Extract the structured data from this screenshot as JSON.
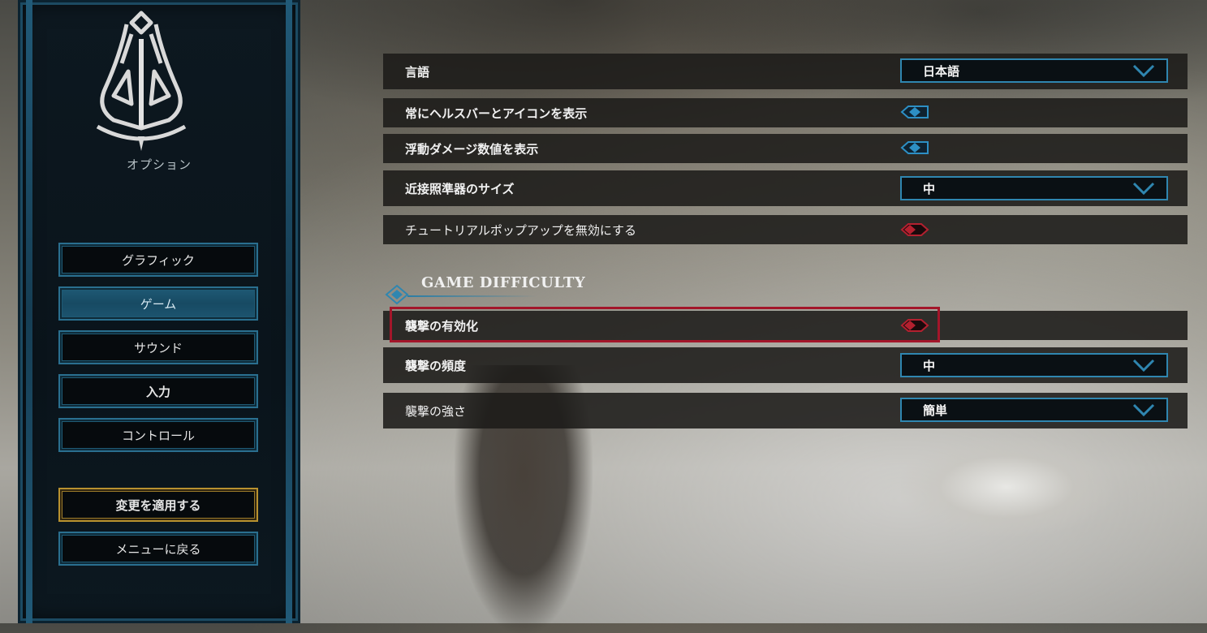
{
  "sidebar": {
    "title": "オプション",
    "logo_icon": "bell-crest-icon",
    "menu": [
      {
        "label": "グラフィック"
      },
      {
        "label": "ゲーム"
      },
      {
        "label": "サウンド"
      },
      {
        "label": "入力"
      },
      {
        "label": "コントロール"
      }
    ],
    "apply_label": "変更を適用する",
    "back_label": "メニューに戻る"
  },
  "settings": {
    "language": {
      "label": "言語",
      "value": "日本語"
    },
    "health_bar": {
      "label": "常にヘルスバーとアイコンを表示",
      "state": "on"
    },
    "floating_damage": {
      "label": "浮動ダメージ数値を表示",
      "state": "on"
    },
    "reticle_size": {
      "label": "近接照準器のサイズ",
      "value": "中"
    },
    "tutorial_popups": {
      "label": "チュートリアルポップアップを無効にする",
      "state": "off"
    }
  },
  "difficulty": {
    "section_title": "GAME DIFFICULTY",
    "raids_enabled": {
      "label": "襲撃の有効化",
      "state": "off"
    },
    "raid_frequency": {
      "label": "襲撃の頻度",
      "value": "中"
    },
    "raid_strength": {
      "label": "襲撃の強さ",
      "value": "簡単"
    }
  },
  "colors": {
    "accent_blue": "#2f86b0",
    "toggle_on": "#2d8fc4",
    "toggle_off": "#b3202f",
    "highlight": "#a3162a",
    "gold": "#b8912f"
  }
}
